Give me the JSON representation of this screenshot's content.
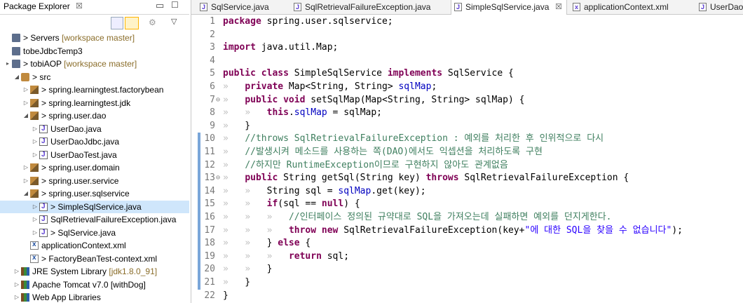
{
  "package_explorer": {
    "title": "Package Explorer",
    "close_glyph": "☒",
    "tree": [
      {
        "label": "> Servers",
        "decoration": "[workspace master]",
        "icon": "project",
        "twisty": ""
      },
      {
        "label": "tobeJdbcTemp3",
        "decoration": "",
        "icon": "project",
        "twisty": ""
      },
      {
        "label": "> tobiAOP",
        "decoration": "[workspace master]",
        "icon": "project",
        "twisty": "▸"
      },
      {
        "label": "> src",
        "decoration": "",
        "icon": "src",
        "twisty": "◢"
      },
      {
        "label": "> spring.learningtest.factorybean",
        "decoration": "",
        "icon": "package",
        "twisty": "▷"
      },
      {
        "label": "> spring.learningtest.jdk",
        "decoration": "",
        "icon": "package",
        "twisty": "▷"
      },
      {
        "label": "> spring.user.dao",
        "decoration": "",
        "icon": "package",
        "twisty": "◢"
      },
      {
        "label": "UserDao.java",
        "decoration": "",
        "icon": "java",
        "twisty": "▷"
      },
      {
        "label": "UserDaoJdbc.java",
        "decoration": "",
        "icon": "java",
        "twisty": "▷"
      },
      {
        "label": "UserDaoTest.java",
        "decoration": "",
        "icon": "java",
        "twisty": "▷"
      },
      {
        "label": "> spring.user.domain",
        "decoration": "",
        "icon": "package",
        "twisty": "▷"
      },
      {
        "label": "> spring.user.service",
        "decoration": "",
        "icon": "package",
        "twisty": "▷"
      },
      {
        "label": "> spring.user.sqlservice",
        "decoration": "",
        "icon": "package",
        "twisty": "◢"
      },
      {
        "label": "> SimpleSqlService.java",
        "decoration": "",
        "icon": "java",
        "twisty": "▷",
        "selected": true
      },
      {
        "label": "SqlRetrievalFailureException.java",
        "decoration": "",
        "icon": "java",
        "twisty": "▷"
      },
      {
        "label": "> SqlService.java",
        "decoration": "",
        "icon": "java",
        "twisty": "▷"
      },
      {
        "label": "applicationContext.xml",
        "decoration": "",
        "icon": "xml",
        "twisty": ""
      },
      {
        "label": "> FactoryBeanTest-context.xml",
        "decoration": "",
        "icon": "xml",
        "twisty": ""
      },
      {
        "label": "JRE System Library",
        "decoration": "[jdk1.8.0_91]",
        "icon": "library",
        "twisty": "▷"
      },
      {
        "label": "Apache Tomcat v7.0 [withDog]",
        "decoration": "",
        "icon": "library",
        "twisty": "▷"
      },
      {
        "label": "Web App Libraries",
        "decoration": "",
        "icon": "library",
        "twisty": "▷"
      }
    ]
  },
  "editor": {
    "tabs": [
      {
        "label": "SqlService.java",
        "icon": "J",
        "active": false
      },
      {
        "label": "SqlRetrievalFailureException.java",
        "icon": "J",
        "active": false
      },
      {
        "label": "SimpleSqlService.java",
        "icon": "J",
        "active": true,
        "close_glyph": "☒"
      },
      {
        "label": "applicationContext.xml",
        "icon": "x",
        "active": false
      },
      {
        "label": "UserDao",
        "icon": "J",
        "active": false
      }
    ],
    "lines": [
      {
        "n": "1",
        "mark": "",
        "html": "<span class='kw'>package</span> spring.user.sqlservice;"
      },
      {
        "n": "2",
        "mark": "",
        "html": ""
      },
      {
        "n": "3",
        "mark": "",
        "html": "<span class='kw'>import</span> java.util.Map;"
      },
      {
        "n": "4",
        "mark": "",
        "html": ""
      },
      {
        "n": "5",
        "mark": "",
        "html": "<span class='kw'>public</span> <span class='kw'>class</span> SimpleSqlService <span class='kw'>implements</span> SqlService {"
      },
      {
        "n": "6",
        "mark": "",
        "html": "<span class='tab-mk'>»</span>   <span class='kw'>private</span> Map&lt;String, String&gt; <span class='fld'>sqlMap</span>;"
      },
      {
        "n": "7",
        "mark": "⊖",
        "html": "<span class='tab-mk'>»</span>   <span class='kw'>public</span> <span class='kw'>void</span> setSqlMap(Map&lt;String, String&gt; sqlMap) {"
      },
      {
        "n": "8",
        "mark": "",
        "html": "<span class='tab-mk'>»</span>   <span class='tab-mk'>»</span>   <span class='kw'>this</span>.<span class='fld'>sqlMap</span> = sqlMap;"
      },
      {
        "n": "9",
        "mark": "",
        "html": "<span class='tab-mk'>»</span>   }"
      },
      {
        "n": "10",
        "mark": "",
        "html": "<span class='tab-mk'>»</span>   <span class='cm'>//throws SqlRetrievalFailureException : 예외를 처리한 후 인위적으로 다시</span>"
      },
      {
        "n": "11",
        "mark": "",
        "html": "<span class='tab-mk'>»</span>   <span class='cm'>//발생시켜 메소드를 사용하는 쪽(DAO)에서도 익셉션을 처리하도록 구현</span>"
      },
      {
        "n": "12",
        "mark": "",
        "html": "<span class='tab-mk'>»</span>   <span class='cm'>//하지만 RuntimeException이므로 구현하지 않아도 관계없음</span>"
      },
      {
        "n": "13",
        "mark": "⊖",
        "html": "<span class='tab-mk'>»</span>   <span class='kw'>public</span> String getSql(String key) <span class='kw'>throws</span> SqlRetrievalFailureException {"
      },
      {
        "n": "14",
        "mark": "",
        "html": "<span class='tab-mk'>»</span>   <span class='tab-mk'>»</span>   String sql = <span class='fld'>sqlMap</span>.get(key);"
      },
      {
        "n": "15",
        "mark": "",
        "html": "<span class='tab-mk'>»</span>   <span class='tab-mk'>»</span>   <span class='kw'>if</span>(sql == <span class='kw'>null</span>) {"
      },
      {
        "n": "16",
        "mark": "",
        "html": "<span class='tab-mk'>»</span>   <span class='tab-mk'>»</span>   <span class='tab-mk'>»</span>   <span class='cm'>//인터페이스 정의된 규약대로 SQL을 가져오는데 실패하면 예외를 던지게한다.</span>"
      },
      {
        "n": "17",
        "mark": "",
        "html": "<span class='tab-mk'>»</span>   <span class='tab-mk'>»</span>   <span class='tab-mk'>»</span>   <span class='kw'>throw</span> <span class='kw'>new</span> SqlRetrievalFailureException(key+<span class='str'>\"에 대한 SQL을 찾을 수 없습니다\"</span>);"
      },
      {
        "n": "18",
        "mark": "",
        "html": "<span class='tab-mk'>»</span>   <span class='tab-mk'>»</span>   } <span class='kw'>else</span> {"
      },
      {
        "n": "19",
        "mark": "",
        "html": "<span class='tab-mk'>»</span>   <span class='tab-mk'>»</span>   <span class='tab-mk'>»</span>   <span class='kw'>return</span> sql;"
      },
      {
        "n": "20",
        "mark": "",
        "html": "<span class='tab-mk'>»</span>   <span class='tab-mk'>»</span>   }"
      },
      {
        "n": "21",
        "mark": "",
        "html": "<span class='tab-mk'>»</span>   }"
      },
      {
        "n": "22",
        "mark": "",
        "html": "}"
      }
    ]
  }
}
